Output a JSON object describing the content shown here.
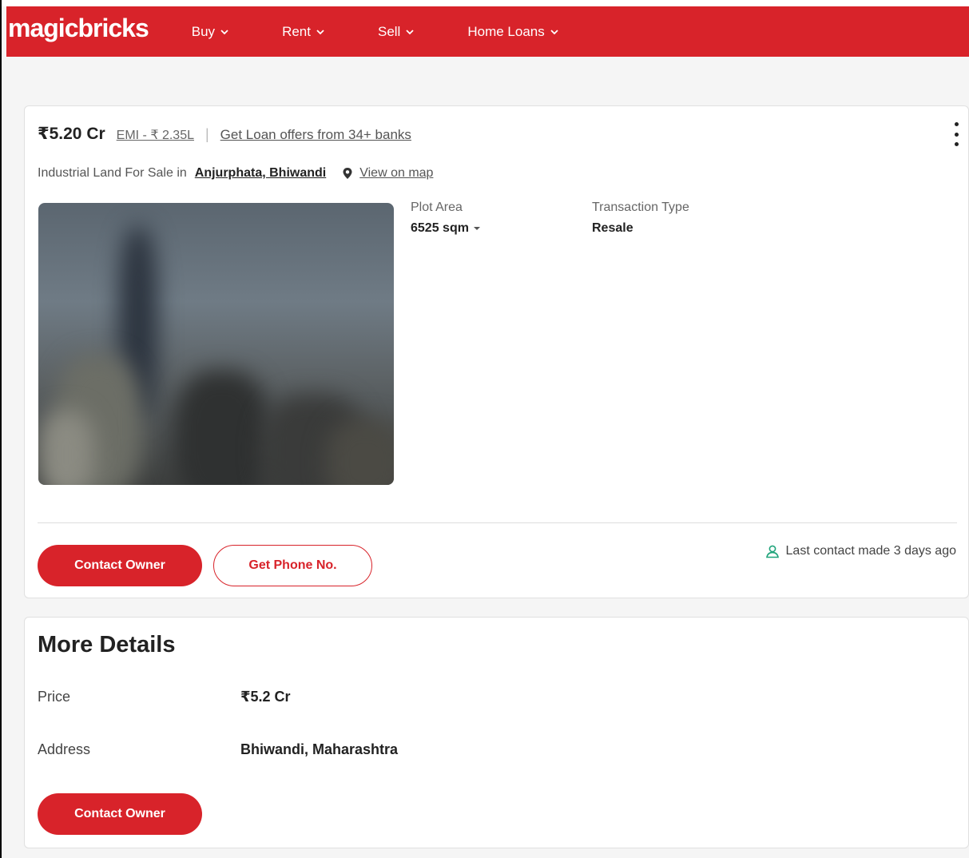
{
  "header": {
    "logo": "magicbricks",
    "nav": [
      {
        "label": "Buy"
      },
      {
        "label": "Rent"
      },
      {
        "label": "Sell"
      },
      {
        "label": "Home Loans"
      }
    ]
  },
  "listing": {
    "price": "₹5.20 Cr",
    "emi": "EMI - ₹ 2.35L",
    "separator": "|",
    "loan_offer": "Get Loan offers from 34+ banks",
    "title_prefix": "Industrial Land For Sale in",
    "locality": "Anjurphata, Bhiwandi",
    "map_link": "View on map",
    "summary": [
      {
        "label": "Plot Area",
        "value": "6525 sqm"
      },
      {
        "label": "Transaction Type",
        "value": "Resale"
      }
    ],
    "contact_button": "Contact Owner",
    "phone_button": "Get Phone No.",
    "last_contact": "Last contact made 3 days ago"
  },
  "more_details": {
    "title": "More Details",
    "rows": [
      {
        "label": "Price",
        "value": "₹5.2 Cr"
      },
      {
        "label": "Address",
        "value": "Bhiwandi, Maharashtra"
      }
    ],
    "contact_button": "Contact Owner"
  },
  "colors": {
    "brand": "#d8232a",
    "contact_icon": "#1fa37a"
  }
}
